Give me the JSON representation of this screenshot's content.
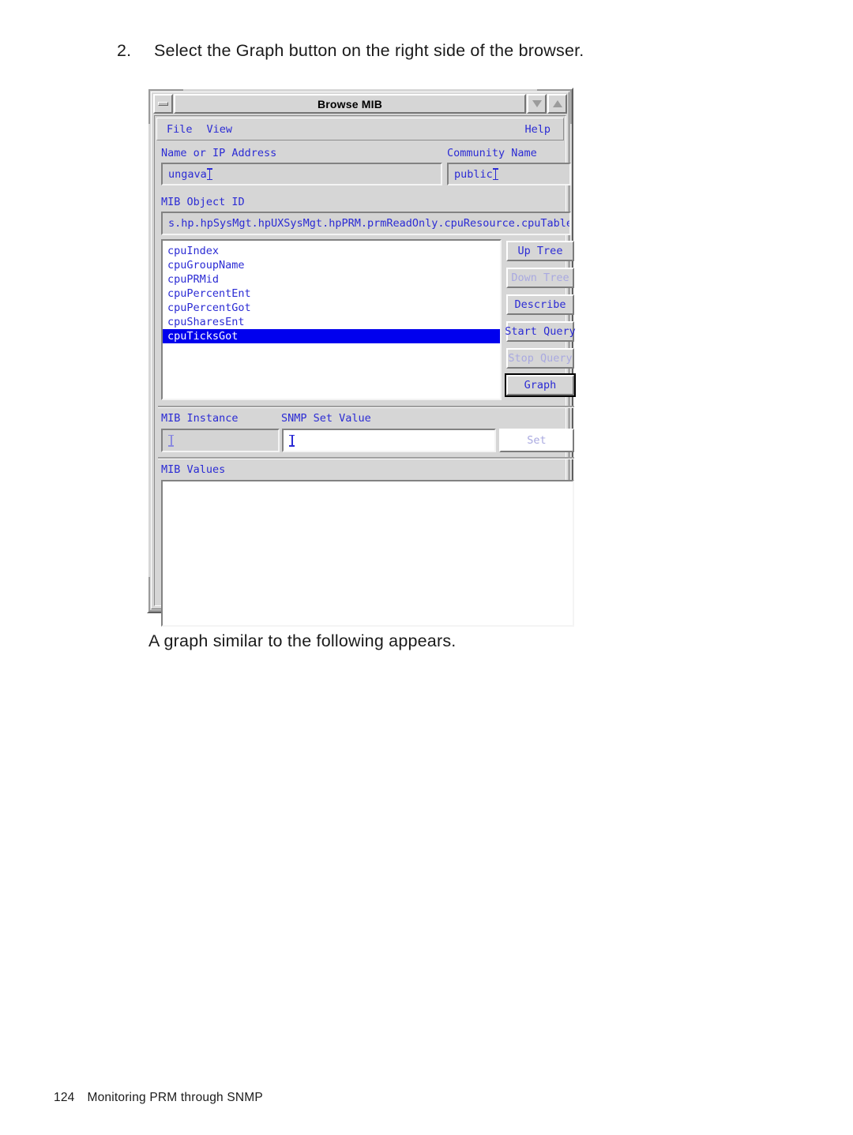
{
  "document": {
    "step_number": "2.",
    "step_text": "Select the Graph button on the right side of the browser.",
    "after_text": "A graph similar to the following appears.",
    "footer_page": "124",
    "footer_title": "Monitoring PRM through SNMP"
  },
  "window": {
    "title": "Browse MIB",
    "menubar": {
      "file": "File",
      "view": "View",
      "help": "Help"
    },
    "fields": {
      "host_label": "Name or IP Address",
      "host_value": "ungava",
      "community_label": "Community Name",
      "community_value": "public",
      "oid_label": "MIB Object ID",
      "oid_value": "s.hp.hpSysMgt.hpUXSysMgt.hpPRM.prmReadOnly.cpuResource.cpuTable.cpuRecord",
      "instance_label": "MIB Instance",
      "instance_value": "",
      "setvalue_label": "SNMP Set Value",
      "setvalue_value": "",
      "values_label": "MIB Values",
      "values_content": ""
    },
    "mib_list": [
      {
        "label": "cpuIndex",
        "selected": false
      },
      {
        "label": "cpuGroupName",
        "selected": false
      },
      {
        "label": "cpuPRMid",
        "selected": false
      },
      {
        "label": "cpuPercentEnt",
        "selected": false
      },
      {
        "label": "cpuPercentGot",
        "selected": false
      },
      {
        "label": "cpuSharesEnt",
        "selected": false
      },
      {
        "label": "cpuTicksGot",
        "selected": true
      }
    ],
    "buttons": {
      "up_tree": "Up Tree",
      "down_tree": "Down Tree",
      "describe": "Describe",
      "start_query": "Start Query",
      "stop_query": "Stop Query",
      "graph": "Graph",
      "set": "Set"
    },
    "colors": {
      "face": "#d6d6d6",
      "text_blue": "#2b2bd4",
      "disabled_blue": "#a9a9e0",
      "selection": "#0000ee",
      "field_bg": "#d4d4d4"
    }
  }
}
